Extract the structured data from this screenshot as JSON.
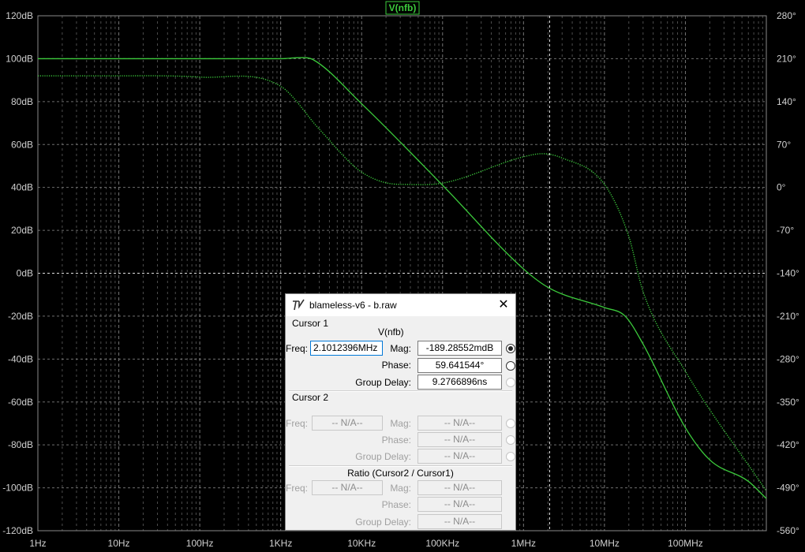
{
  "plot": {
    "trace_label": "V(nfb)",
    "colors": {
      "background": "#000000",
      "grid": "#8a8a8a",
      "trace": "#3ccb3c",
      "axis_text": "#d0d0d0"
    },
    "left_axis_labels": [
      "120dB",
      "100dB",
      "80dB",
      "60dB",
      "40dB",
      "20dB",
      "0dB",
      "-20dB",
      "-40dB",
      "-60dB",
      "-80dB",
      "-100dB",
      "-120dB"
    ],
    "right_axis_labels": [
      "280°",
      "210°",
      "140°",
      "70°",
      "0°",
      "-70°",
      "-140°",
      "-210°",
      "-280°",
      "-350°",
      "-420°",
      "-490°",
      "-560°"
    ],
    "x_axis_labels": [
      "1Hz",
      "10Hz",
      "100Hz",
      "1KHz",
      "10KHz",
      "100KHz",
      "1MHz",
      "10MHz",
      "100MHz"
    ]
  },
  "chart_data": {
    "type": "line",
    "x_scale": "log",
    "xlim_hz": [
      1,
      1000000000
    ],
    "ylim_db": [
      -120,
      120
    ],
    "y2lim_deg": [
      -560,
      280
    ],
    "grid": true,
    "cursor_freq_hz": 2101239.6,
    "series": [
      {
        "name": "V(nfb)",
        "axis": "left",
        "style": "solid",
        "x": [
          1,
          100,
          1000,
          1500,
          1900,
          2500,
          10000,
          100000,
          1000000,
          2100000,
          10000000,
          18000000,
          30000000,
          100000000,
          200000000,
          600000000,
          1000000000
        ],
        "y": [
          100,
          100,
          100,
          100.4,
          100.5,
          99.6,
          79,
          41,
          2,
          -7,
          -16,
          -20,
          -33,
          -72,
          -87,
          -97,
          -105
        ]
      },
      {
        "name": "phase",
        "axis": "right",
        "style": "dotted",
        "x": [
          1,
          10,
          100,
          1000,
          3000,
          10000,
          30000,
          100000,
          1000000,
          1700000,
          3000000,
          10000000,
          20000000,
          30000000,
          100000000,
          1000000000
        ],
        "y": [
          182,
          182,
          180,
          165,
          95,
          25,
          5,
          7,
          50,
          55,
          48,
          5,
          -80,
          -170,
          -300,
          -495
        ]
      }
    ]
  },
  "dialog": {
    "title": "blameless-v6 - b.raw",
    "close": "✕",
    "cursor1": {
      "group": "Cursor 1",
      "trace": "V(nfb)",
      "freq_label": "Freq:",
      "freq_value": "2.1012396MHz",
      "mag_label": "Mag:",
      "mag_value": "-189.28552mdB",
      "phase_label": "Phase:",
      "phase_value": "59.641544°",
      "gd_label": "Group Delay:",
      "gd_value": "9.2766896ns"
    },
    "cursor2": {
      "group": "Cursor 2",
      "freq_label": "Freq:",
      "freq_value": "-- N/A--",
      "mag_label": "Mag:",
      "mag_value": "-- N/A--",
      "phase_label": "Phase:",
      "phase_value": "-- N/A--",
      "gd_label": "Group Delay:",
      "gd_value": "-- N/A--"
    },
    "ratio": {
      "group": "Ratio (Cursor2 / Cursor1)",
      "freq_label": "Freq:",
      "freq_value": "-- N/A--",
      "mag_label": "Mag:",
      "mag_value": "-- N/A--",
      "phase_label": "Phase:",
      "phase_value": "-- N/A--",
      "gd_label": "Group Delay:",
      "gd_value": "-- N/A--"
    }
  }
}
